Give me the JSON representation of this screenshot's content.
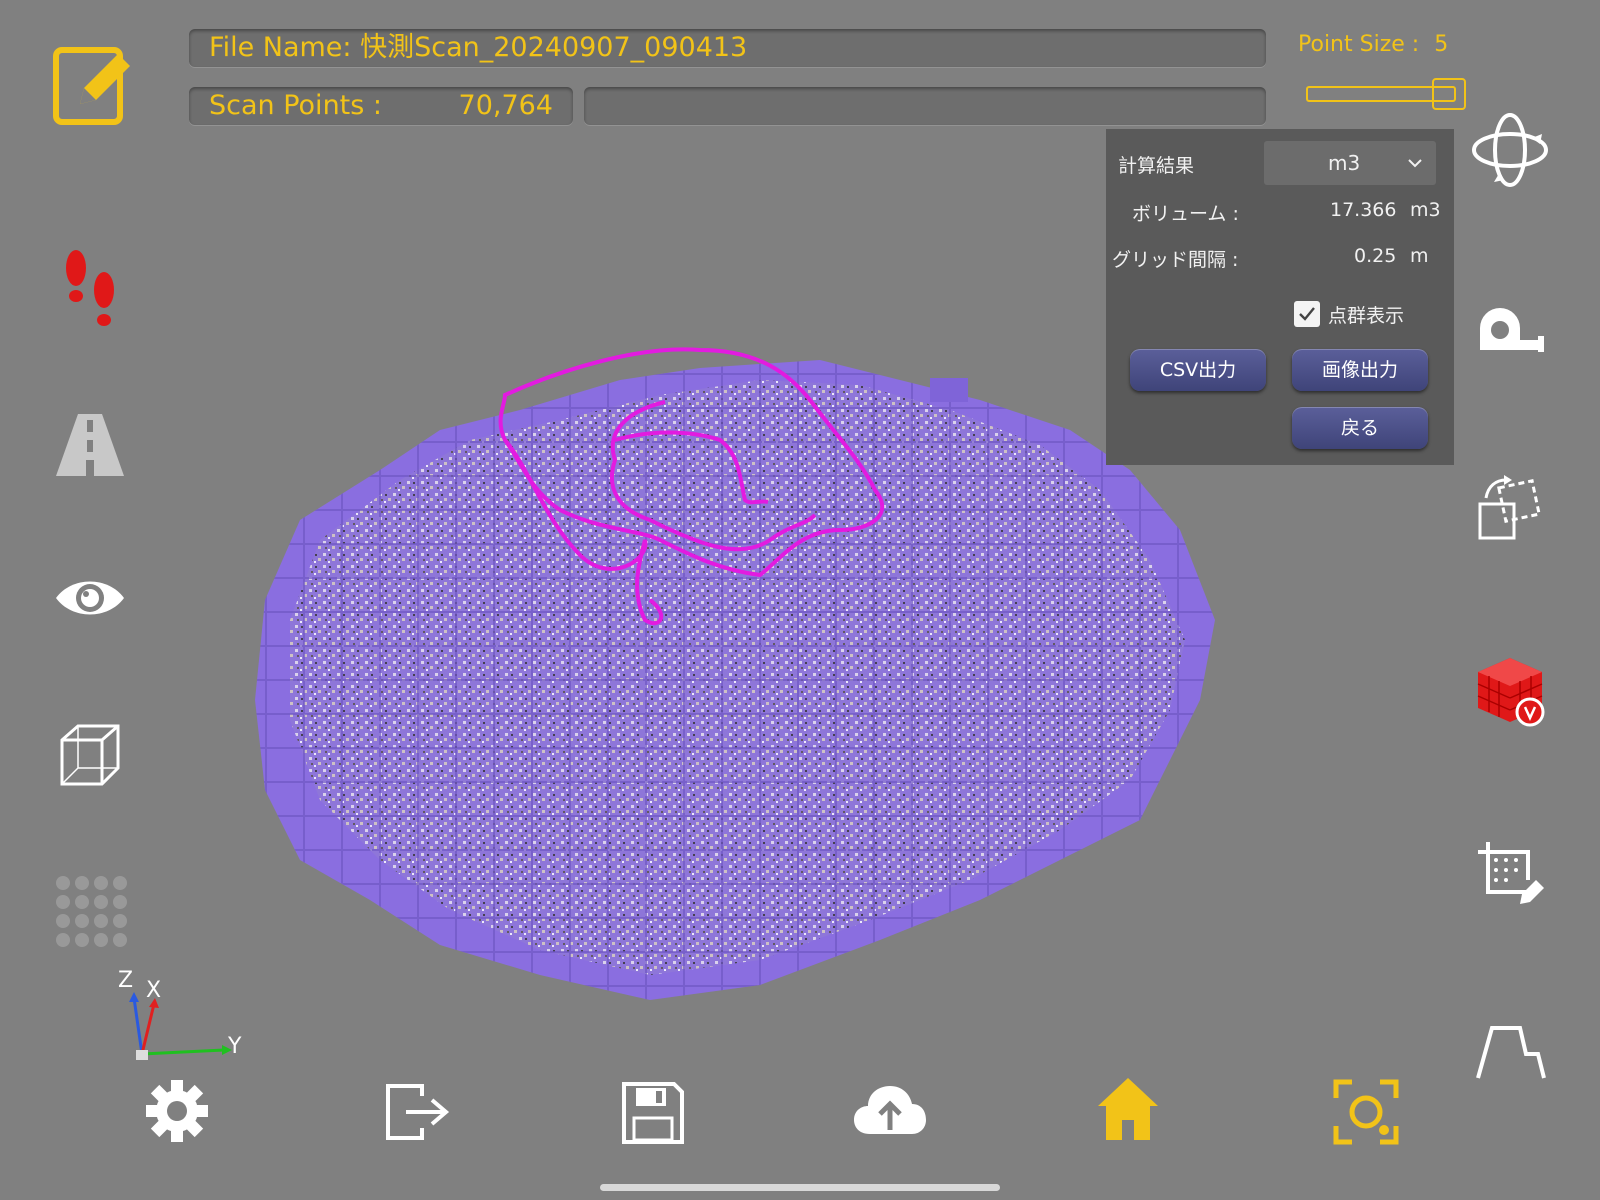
{
  "header": {
    "file_name": "File Name: 快測Scan_20240907_090413",
    "scan_points_label": "Scan Points :",
    "scan_points_value": "70,764",
    "point_size_label": "Point Size :",
    "point_size_value": "5",
    "point_size_slider_level": 0.9
  },
  "panel": {
    "result_label": "計算結果",
    "unit_select": "m3",
    "volume_label": "ボリューム :",
    "volume_value": "17.366",
    "volume_unit": "m3",
    "grid_label": "グリッド間隔 :",
    "grid_value": "0.25",
    "grid_unit": "m",
    "pointcloud_label": "点群表示",
    "pointcloud_checked": true,
    "csv_button": "CSV出力",
    "image_button": "画像出力",
    "back_button": "戻る"
  },
  "axes": {
    "z": "Z",
    "x": "X",
    "y": "Y"
  },
  "colors": {
    "accent_yellow": "#f2c318",
    "voxel_purple": "#8a6ee0",
    "boundary_magenta": "#e21be0",
    "active_red": "#e01818"
  },
  "icons": {
    "left": [
      "edit-icon",
      "footsteps-icon",
      "road-icon",
      "eye-icon",
      "wireframe-cube-icon",
      "dot-grid-icon"
    ],
    "right": [
      "orbit-icon",
      "tape-measure-icon",
      "transform-icon",
      "volume-voxel-icon",
      "crop-area-icon",
      "profile-icon"
    ],
    "bottom": [
      "settings-icon",
      "exit-icon",
      "save-icon",
      "cloud-upload-icon",
      "home-icon",
      "camera-scan-icon"
    ]
  }
}
